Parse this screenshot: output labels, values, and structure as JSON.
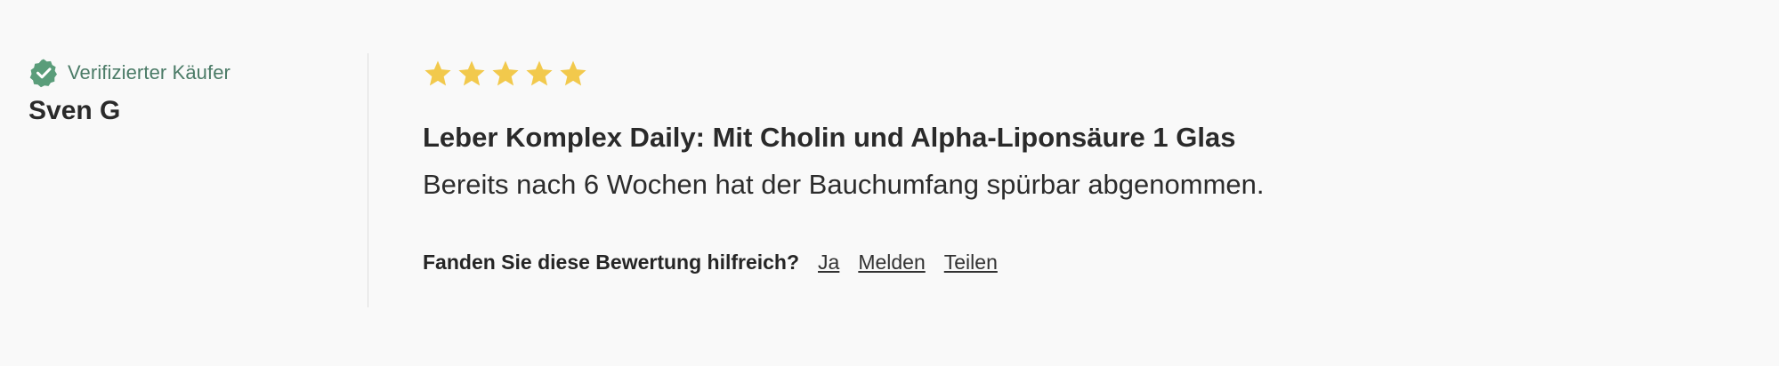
{
  "review": {
    "verified_label": "Verifizierter Käufer",
    "author_name": "Sven G",
    "rating": 5,
    "rating_max": 5,
    "star_color": "#f2c94c",
    "verified_color": "#5a9d7a",
    "title": "Leber Komplex Daily: Mit Cholin und Alpha-Liponsäure 1 Glas",
    "body": "Bereits nach 6 Wochen hat der Bauchumfang spürbar abgenommen.",
    "helpful_question": "Fanden Sie diese Bewertung hilfreich?",
    "actions": {
      "yes": "Ja",
      "report": "Melden",
      "share": "Teilen"
    }
  }
}
